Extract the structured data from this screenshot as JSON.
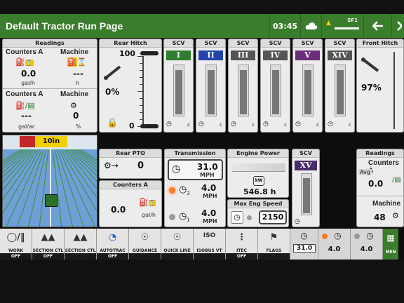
{
  "topbar": {
    "title": "Default Tractor Run Page",
    "time": "03:45",
    "sf": "SF1"
  },
  "readings_left": {
    "header": "Readings",
    "counters_label_1": "Counters A",
    "machine_label_1": "Machine",
    "counter_value_1": "0.0",
    "counter_unit_1": "gal/h",
    "machine_value_1": "---",
    "machine_unit_1": "h",
    "counters_label_2": "Counters A",
    "machine_label_2": "Machine",
    "counter_value_2": "---",
    "counter_unit_2": "gal/ac",
    "machine_value_2": "0",
    "machine_unit_2": "%"
  },
  "rear_hitch": {
    "header": "Rear Hitch",
    "top_value": "100",
    "percent": "0%",
    "bottom_value": "0",
    "level": 0
  },
  "scv": [
    {
      "header": "SCV",
      "roman": "I",
      "color": "#2f7d2f",
      "level": 0.9
    },
    {
      "header": "SCV",
      "roman": "II",
      "color": "#2244aa",
      "level": 0.9
    },
    {
      "header": "SCV",
      "roman": "III",
      "color": "#555555",
      "level": 0.9
    },
    {
      "header": "SCV",
      "roman": "IV",
      "color": "#555555",
      "level": 0.9
    },
    {
      "header": "SCV",
      "roman": "V",
      "color": "#6a2e7a",
      "level": 0.9
    },
    {
      "header": "SCV",
      "roman": "XIV",
      "color": "#555555",
      "level": 0.9
    }
  ],
  "scv_xv": {
    "header": "SCV",
    "roman": "XV",
    "color": "#4a2c6a",
    "level": 0.9
  },
  "front_hitch": {
    "header": "Front Hitch",
    "percent": "97%",
    "level": 0.97
  },
  "guidance_view": {
    "swath": "10in"
  },
  "rear_pto": {
    "header": "Rear PTO",
    "value": "0"
  },
  "counters_a": {
    "header": "Counters A",
    "value": "0.0",
    "unit": "gal/h"
  },
  "transmission": {
    "header": "Transmission",
    "speed": "31.0",
    "speed_unit": "MPH",
    "gear2_value": "4.0",
    "gear2_unit": "MPH",
    "gear1_value": "4.0",
    "gear1_unit": "MPH"
  },
  "engine_power": {
    "header": "Engine Power",
    "hours": "546.8 h"
  },
  "max_eng_speed": {
    "header": "Max Eng Speed",
    "value": "2150"
  },
  "readings_right": {
    "header": "Readings",
    "counters_label": "Counters A",
    "avg": "Avg",
    "counter_value": "0.0",
    "machine_label": "Machine",
    "machine_value": "48"
  },
  "buttons": [
    {
      "label": "WORK",
      "status": "OFF"
    },
    {
      "label": "SECTION CTL",
      "status": "OFF"
    },
    {
      "label": "SECTION CTL",
      "status": ""
    },
    {
      "label": "AUTOTRAC",
      "status": "OFF"
    },
    {
      "label": "GUIDANCE",
      "status": ""
    },
    {
      "label": "QUICK LINE",
      "status": ""
    },
    {
      "label": "ISOBUS VT",
      "status": ""
    },
    {
      "label": "ITEC",
      "status": "OFF"
    },
    {
      "label": "FLAGS",
      "status": ""
    }
  ],
  "quick_buttons": {
    "speed": "31.0",
    "gear2": "4.0",
    "gear1": "4.0",
    "menu": "MEN"
  }
}
